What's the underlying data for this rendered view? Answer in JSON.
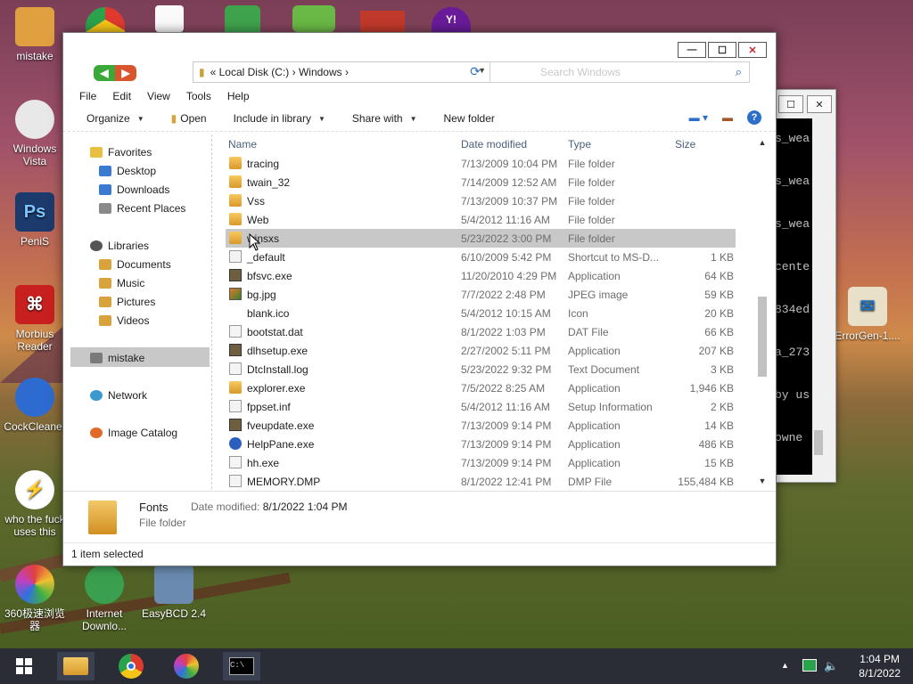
{
  "desktop_icons": [
    {
      "label": "mistake",
      "color": "#e0a040"
    },
    {
      "label": "Windows Vista",
      "color": "#e8e8e8"
    },
    {
      "label": "PeniS",
      "color": "#1c3a6b"
    },
    {
      "label": "Morbius Reader",
      "color": "#c8201e"
    },
    {
      "label": "CockCleaner",
      "color": "#2e6bd0"
    },
    {
      "label": "who the fuck uses this",
      "color": "#e04a1a"
    },
    {
      "label": "360极速浏览器",
      "color": "#e06aa0"
    },
    {
      "label": "Internet Downlo...",
      "color": "#3aa050"
    },
    {
      "label": "EasyBCD 2.4",
      "color": "#6a8ab0"
    },
    {
      "label": "ErrorGen-1....",
      "color": "#2070c0"
    }
  ],
  "console": {
    "lines": [
      "s_wea",
      "s_wea",
      "s_wea",
      "cente",
      "834ed",
      "a_273",
      "by us",
      "owne"
    ]
  },
  "explorer": {
    "address": {
      "breadcrumb": "«  Local Disk (C:)  ›  Windows  ›"
    },
    "search": {
      "placeholder": "Search Windows"
    },
    "menu": [
      "File",
      "Edit",
      "View",
      "Tools",
      "Help"
    ],
    "toolbar": {
      "organize": "Organize",
      "open": "Open",
      "include": "Include in library",
      "share": "Share with",
      "new_folder": "New folder"
    },
    "nav": {
      "favorites": "Favorites",
      "desktop": "Desktop",
      "downloads": "Downloads",
      "recent": "Recent Places",
      "libraries": "Libraries",
      "documents": "Documents",
      "music": "Music",
      "pictures": "Pictures",
      "videos": "Videos",
      "mistake": "mistake",
      "network": "Network",
      "image_catalog": "Image Catalog"
    },
    "columns": {
      "name": "Name",
      "date": "Date modified",
      "type": "Type",
      "size": "Size"
    },
    "files": [
      {
        "name": "tracing",
        "date": "7/13/2009 10:04 PM",
        "type": "File folder",
        "size": "",
        "icon": "folder"
      },
      {
        "name": "twain_32",
        "date": "7/14/2009 12:52 AM",
        "type": "File folder",
        "size": "",
        "icon": "folder"
      },
      {
        "name": "Vss",
        "date": "7/13/2009 10:37 PM",
        "type": "File folder",
        "size": "",
        "icon": "folder"
      },
      {
        "name": "Web",
        "date": "5/4/2012 11:16 AM",
        "type": "File folder",
        "size": "",
        "icon": "folder"
      },
      {
        "name": "winsxs",
        "date": "5/23/2022 3:00 PM",
        "type": "File folder",
        "size": "",
        "icon": "folder"
      },
      {
        "name": "_default",
        "date": "6/10/2009 5:42 PM",
        "type": "Shortcut to MS-D...",
        "size": "1 KB",
        "icon": "doc"
      },
      {
        "name": "bfsvc.exe",
        "date": "11/20/2010 4:29 PM",
        "type": "Application",
        "size": "64 KB",
        "icon": "app"
      },
      {
        "name": "bg.jpg",
        "date": "7/7/2022 2:48 PM",
        "type": "JPEG image",
        "size": "59 KB",
        "icon": "img"
      },
      {
        "name": "blank.ico",
        "date": "5/4/2012 10:15 AM",
        "type": "Icon",
        "size": "20 KB",
        "icon": "none"
      },
      {
        "name": "bootstat.dat",
        "date": "8/1/2022 1:03 PM",
        "type": "DAT File",
        "size": "66 KB",
        "icon": "doc"
      },
      {
        "name": "dlhsetup.exe",
        "date": "2/27/2002 5:11 PM",
        "type": "Application",
        "size": "207 KB",
        "icon": "app"
      },
      {
        "name": "DtcInstall.log",
        "date": "5/23/2022 9:32 PM",
        "type": "Text Document",
        "size": "3 KB",
        "icon": "doc"
      },
      {
        "name": "explorer.exe",
        "date": "7/5/2022 8:25 AM",
        "type": "Application",
        "size": "1,946 KB",
        "icon": "folder"
      },
      {
        "name": "fppset.inf",
        "date": "5/4/2012 11:16 AM",
        "type": "Setup Information",
        "size": "2 KB",
        "icon": "doc"
      },
      {
        "name": "fveupdate.exe",
        "date": "7/13/2009 9:14 PM",
        "type": "Application",
        "size": "14 KB",
        "icon": "app"
      },
      {
        "name": "HelpPane.exe",
        "date": "7/13/2009 9:14 PM",
        "type": "Application",
        "size": "486 KB",
        "icon": "help"
      },
      {
        "name": "hh.exe",
        "date": "7/13/2009 9:14 PM",
        "type": "Application",
        "size": "15 KB",
        "icon": "doc"
      },
      {
        "name": "MEMORY.DMP",
        "date": "8/1/2022 12:41 PM",
        "type": "DMP File",
        "size": "155,484 KB",
        "icon": "doc"
      }
    ],
    "details": {
      "name": "Fonts",
      "modified_label": "Date modified:",
      "modified_value": "8/1/2022 1:04 PM",
      "type": "File folder"
    },
    "status": "1 item selected"
  },
  "taskbar": {
    "time": "1:04 PM",
    "date": "8/1/2022"
  }
}
